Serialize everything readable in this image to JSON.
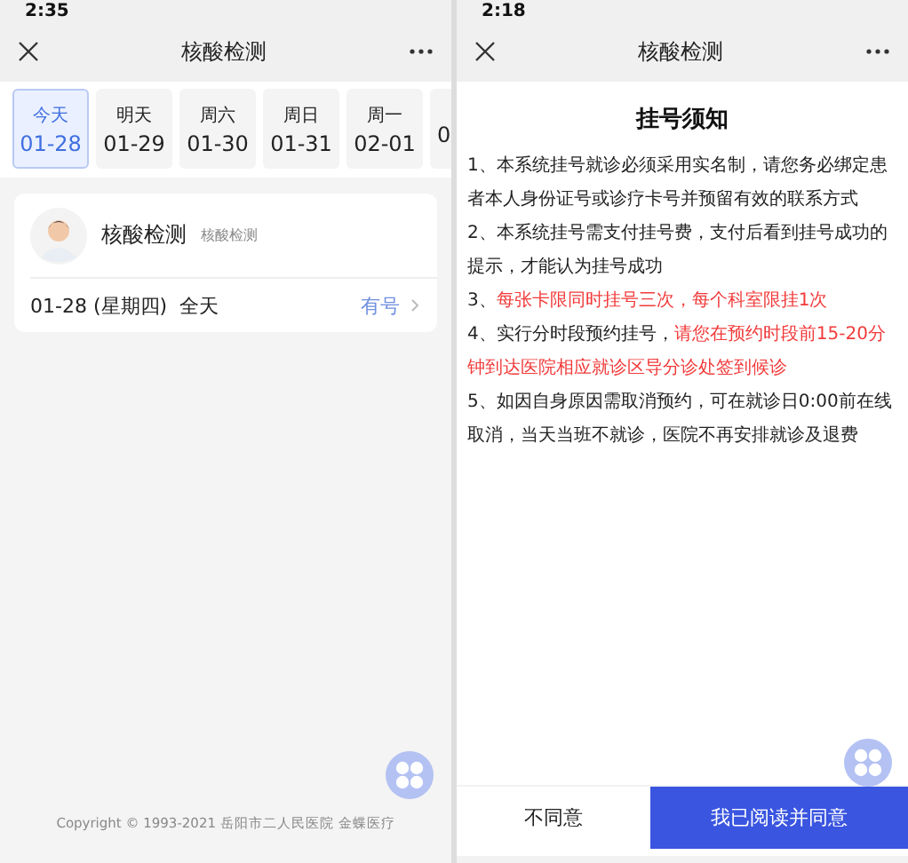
{
  "left": {
    "status_time": "2:35",
    "title": "核酸检测",
    "dates": [
      {
        "day": "今天",
        "date": "01-28",
        "selected": true
      },
      {
        "day": "明天",
        "date": "01-29",
        "selected": false
      },
      {
        "day": "周六",
        "date": "01-30",
        "selected": false
      },
      {
        "day": "周日",
        "date": "01-31",
        "selected": false
      },
      {
        "day": "周一",
        "date": "02-01",
        "selected": false
      },
      {
        "date": "0",
        "selected": false
      }
    ],
    "card": {
      "name": "核酸检测",
      "subtitle": "核酸检测",
      "schedule": "01-28 (星期四)  全天",
      "availability": "有号"
    },
    "copyright": "Copyright © 1993-2021 岳阳市二人民医院 金蝶医疗"
  },
  "right": {
    "status_time": "2:18",
    "title": "核酸检测",
    "notice_title": "挂号须知",
    "notes": [
      [
        {
          "text": "1、本系统挂号就诊必须采用实名制，请您务必绑定患者本人身份证号或诊疗卡号并预留有效的联系方式",
          "emphasis": false
        }
      ],
      [
        {
          "text": "2、本系统挂号需支付挂号费，支付后看到挂号成功的提示，才能认为挂号成功",
          "emphasis": false
        }
      ],
      [
        {
          "text": "3、",
          "emphasis": false
        },
        {
          "text": "每张卡限同时挂号三次，每个科室限挂1次",
          "emphasis": true
        }
      ],
      [
        {
          "text": "4、实行分时段预约挂号，",
          "emphasis": false
        },
        {
          "text": "请您在预约时段前15-20分钟到达医院相应就诊区导分诊处签到候诊",
          "emphasis": true
        }
      ],
      [
        {
          "text": "5、如因自身原因需取消预约，可在就诊日0:00前在线取消，当天当班不就诊，医院不再安排就诊及退费",
          "emphasis": false
        }
      ]
    ],
    "buttons": [
      "不同意",
      "我已阅读并同意"
    ]
  }
}
